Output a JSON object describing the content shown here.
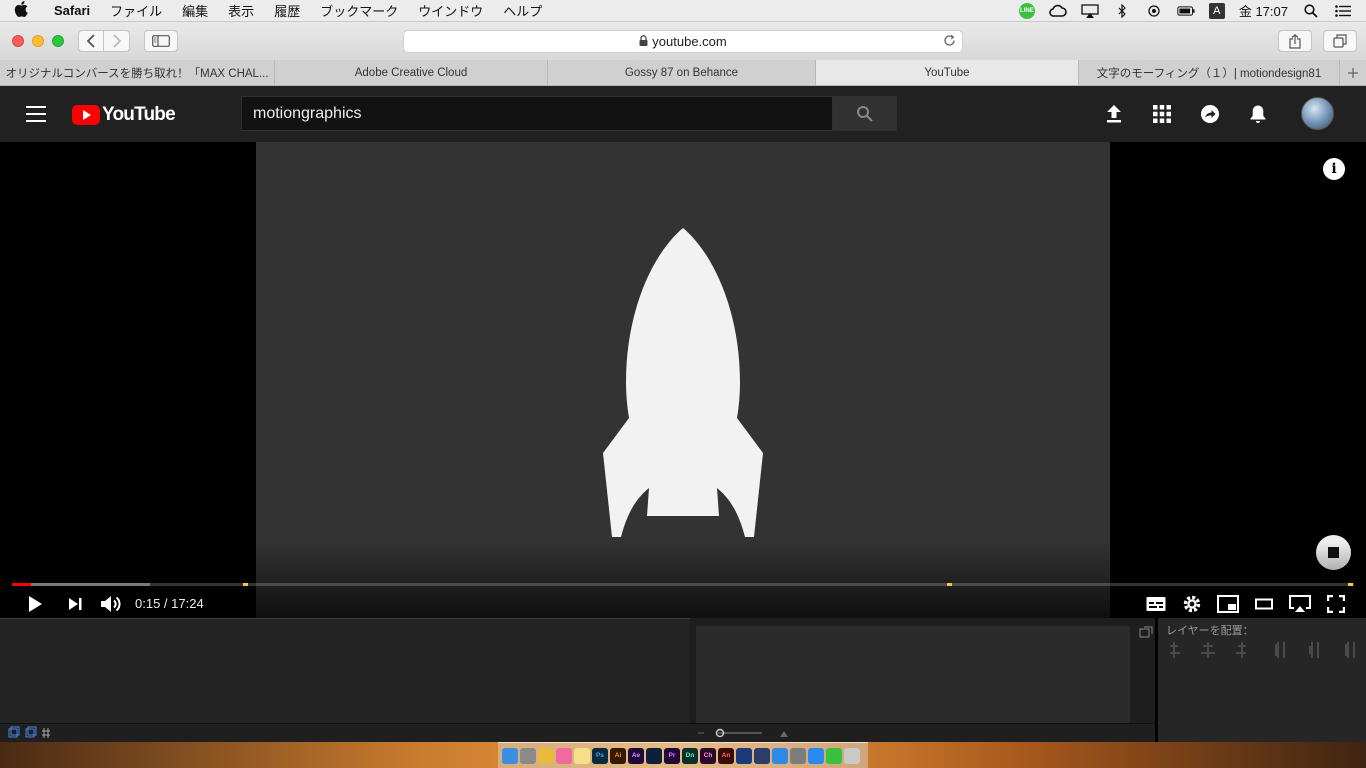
{
  "menubar": {
    "app_name": "Safari",
    "items": [
      "ファイル",
      "編集",
      "表示",
      "履歴",
      "ブックマーク",
      "ウインドウ",
      "ヘルプ"
    ],
    "line_label": "LINE",
    "input_indicator": "A",
    "clock": "金 17:07"
  },
  "browser": {
    "url": "youtube.com",
    "tabs": [
      {
        "title": "オリジナルコンバースを勝ち取れ！「MAX CHAL..."
      },
      {
        "title": "Adobe Creative Cloud"
      },
      {
        "title": "Gossy 87 on Behance"
      },
      {
        "title": "YouTube",
        "active": true
      },
      {
        "title": "文字のモーフィング（１）| motiondesign81"
      }
    ]
  },
  "youtube": {
    "logo_text": "YouTube",
    "search_query": "motiongraphics",
    "brand_color": "#ff0000"
  },
  "player": {
    "time_display": "0:15 / 17:24",
    "played_fraction": 0.0144,
    "buffered_fraction": 0.103,
    "chapter_markers": [
      0.174,
      0.699,
      0.998
    ],
    "info_glyph": "i"
  },
  "underlying_app": {
    "panel_label": "レイヤーを配置："
  },
  "dock": {
    "apps": [
      {
        "name": "finder",
        "label": ""
      },
      {
        "name": "launchpad",
        "label": ""
      },
      {
        "name": "chrome",
        "label": ""
      },
      {
        "name": "itunes",
        "label": ""
      },
      {
        "name": "notes",
        "label": ""
      },
      {
        "name": "photoshop",
        "label": "Ps"
      },
      {
        "name": "illustrator",
        "label": "Ai"
      },
      {
        "name": "after-effects",
        "label": "Ae"
      },
      {
        "name": "media-encoder",
        "label": ""
      },
      {
        "name": "premiere",
        "label": "Pr"
      },
      {
        "name": "dimension",
        "label": "Dn"
      },
      {
        "name": "character-animator",
        "label": "Ch"
      },
      {
        "name": "animate",
        "label": "An"
      },
      {
        "name": "cinema4d",
        "label": ""
      },
      {
        "name": "cinema4d-2",
        "label": ""
      },
      {
        "name": "safari",
        "label": ""
      },
      {
        "name": "system-preferences",
        "label": ""
      },
      {
        "name": "app-store",
        "label": ""
      },
      {
        "name": "line",
        "label": ""
      },
      {
        "name": "trash",
        "label": ""
      }
    ]
  }
}
